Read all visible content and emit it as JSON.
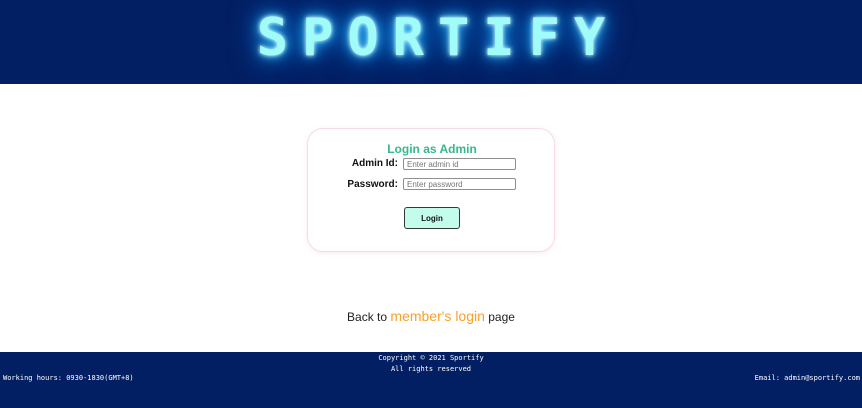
{
  "header": {
    "logo_text": "SPORTIFY"
  },
  "login_card": {
    "title": "Login as Admin",
    "admin_id_label": "Admin Id:",
    "admin_id_placeholder": "Enter admin id",
    "password_label": "Password:",
    "password_placeholder": "Enter password",
    "login_button_label": "Login"
  },
  "back_link": {
    "prefix": "Back to",
    "link_text": "member's login",
    "suffix": "page"
  },
  "footer": {
    "copyright": "Copyright © 2021 Sportify",
    "rights": "All rights reserved",
    "working_hours": "Working hours: 0930-1830(GMT+8)",
    "email": "Email: admin@sportify.com"
  },
  "colors": {
    "header_bg": "#031f63",
    "logo_glow": "#39d7ff",
    "title_green": "#35b98a",
    "button_bg": "#c4fcec",
    "link_orange": "#f7a12a"
  }
}
